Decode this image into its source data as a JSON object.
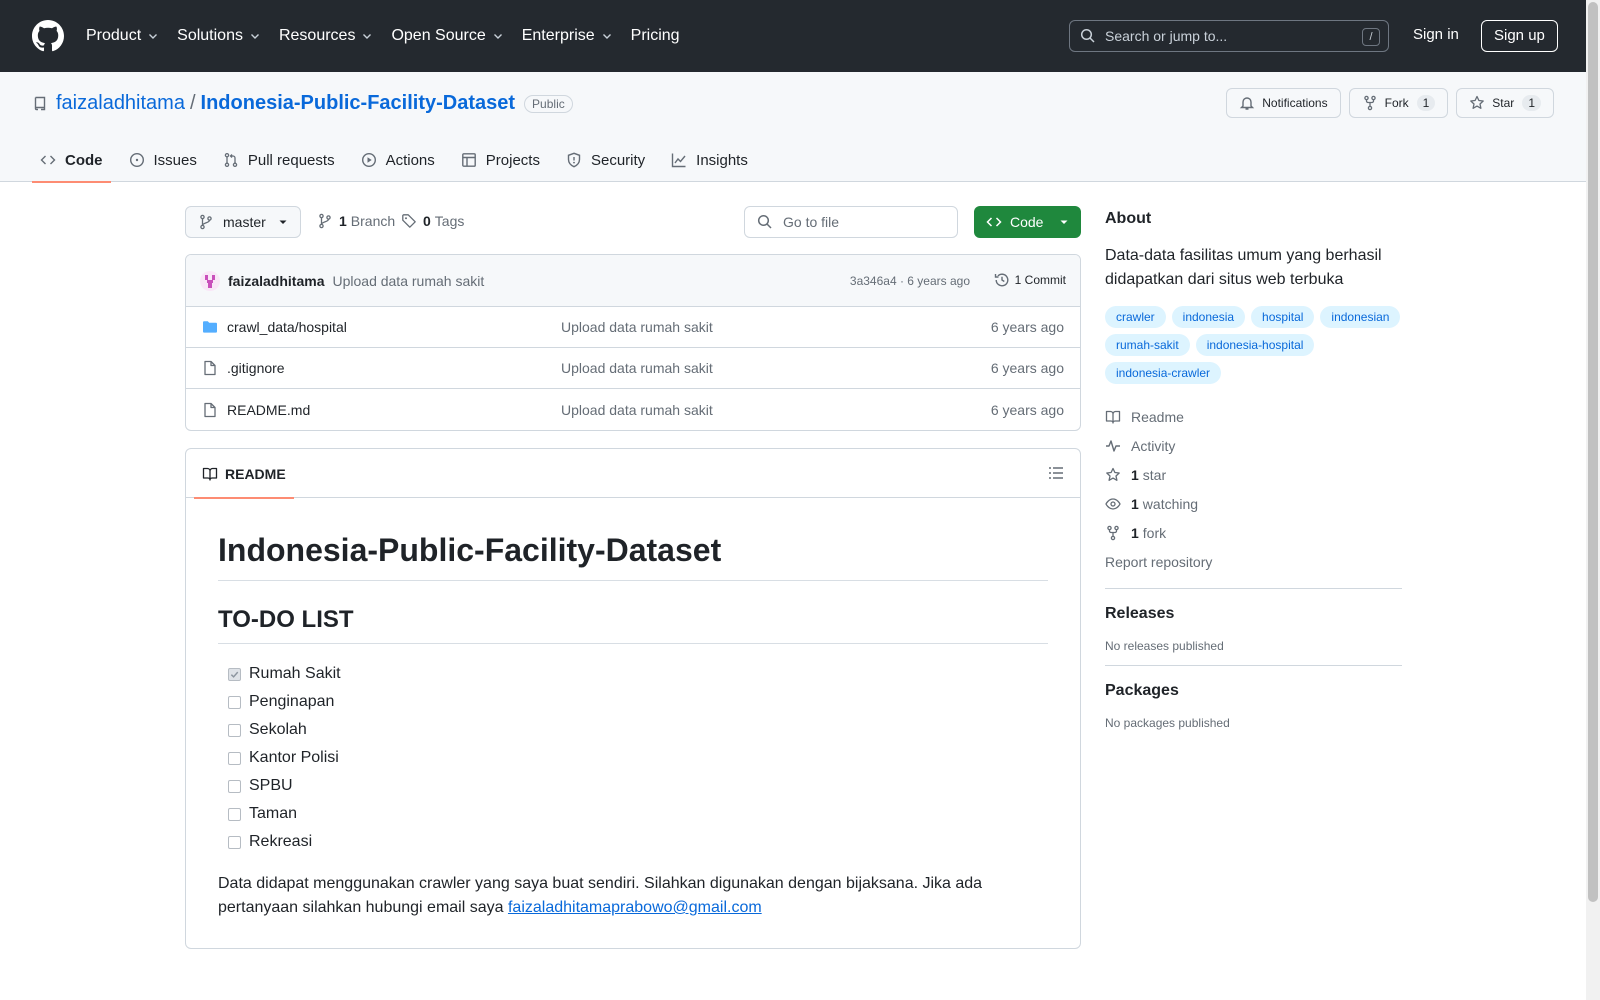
{
  "header": {
    "nav": [
      {
        "label": "Product",
        "dropdown": true
      },
      {
        "label": "Solutions",
        "dropdown": true
      },
      {
        "label": "Resources",
        "dropdown": true
      },
      {
        "label": "Open Source",
        "dropdown": true
      },
      {
        "label": "Enterprise",
        "dropdown": true
      },
      {
        "label": "Pricing",
        "dropdown": false
      }
    ],
    "search_placeholder": "Search or jump to...",
    "search_shortcut": "/",
    "sign_in": "Sign in",
    "sign_up": "Sign up"
  },
  "repo": {
    "owner": "faizaladhitama",
    "separator": "/",
    "name": "Indonesia-Public-Facility-Dataset",
    "visibility": "Public",
    "notifications_label": "Notifications",
    "fork_label": "Fork",
    "fork_count": "1",
    "star_label": "Star",
    "star_count": "1",
    "tabs": [
      {
        "label": "Code",
        "icon": "code-icon",
        "active": true
      },
      {
        "label": "Issues",
        "icon": "issue-icon",
        "active": false
      },
      {
        "label": "Pull requests",
        "icon": "pull-request-icon",
        "active": false
      },
      {
        "label": "Actions",
        "icon": "play-icon",
        "active": false
      },
      {
        "label": "Projects",
        "icon": "table-icon",
        "active": false
      },
      {
        "label": "Security",
        "icon": "shield-icon",
        "active": false
      },
      {
        "label": "Insights",
        "icon": "graph-icon",
        "active": false
      }
    ]
  },
  "toolbar": {
    "branch": "master",
    "branch_count": "1",
    "branch_label": "Branch",
    "tag_count": "0",
    "tag_label": "Tags",
    "goto_placeholder": "Go to file",
    "code_button": "Code"
  },
  "latest_commit": {
    "author": "faizaladhitama",
    "message": "Upload data rumah sakit",
    "sha_time": "3a346a4 · 6 years ago",
    "commits_label": "1 Commit"
  },
  "files": [
    {
      "name": "crawl_data/hospital",
      "type": "folder",
      "message": "Upload data rumah sakit",
      "time": "6 years ago"
    },
    {
      "name": ".gitignore",
      "type": "file",
      "message": "Upload data rumah sakit",
      "time": "6 years ago"
    },
    {
      "name": "README.md",
      "type": "file",
      "message": "Upload data rumah sakit",
      "time": "6 years ago"
    }
  ],
  "readme": {
    "tab_label": "README",
    "h1": "Indonesia-Public-Facility-Dataset",
    "h2": "TO-DO LIST",
    "todo": [
      {
        "label": "Rumah Sakit",
        "checked": true
      },
      {
        "label": "Penginapan",
        "checked": false
      },
      {
        "label": "Sekolah",
        "checked": false
      },
      {
        "label": "Kantor Polisi",
        "checked": false
      },
      {
        "label": "SPBU",
        "checked": false
      },
      {
        "label": "Taman",
        "checked": false
      },
      {
        "label": "Rekreasi",
        "checked": false
      }
    ],
    "paragraph": "Data didapat menggunakan crawler yang saya buat sendiri. Silahkan digunakan dengan bijaksana. Jika ada pertanyaan silahkan hubungi email saya ",
    "email": "faizaladhitamaprabowo@gmail.com"
  },
  "about": {
    "title": "About",
    "description": "Data-data fasilitas umum yang berhasil didapatkan dari situs web terbuka",
    "topics": [
      "crawler",
      "indonesia",
      "hospital",
      "indonesian",
      "rumah-sakit",
      "indonesia-hospital",
      "indonesia-crawler"
    ],
    "readme_label": "Readme",
    "activity_label": "Activity",
    "stars_count": "1",
    "stars_label": "star",
    "watching_count": "1",
    "watching_label": "watching",
    "forks_count": "1",
    "forks_label": "fork",
    "report_label": "Report repository"
  },
  "releases": {
    "title": "Releases",
    "empty": "No releases published"
  },
  "packages": {
    "title": "Packages",
    "empty": "No packages published"
  },
  "colors": {
    "header_bg": "#24292f",
    "link": "#0969da",
    "primary_button": "#1f883d",
    "active_tab_underline": "#fd8c73",
    "topic_bg": "#ddf4ff",
    "folder": "#54aeff"
  }
}
